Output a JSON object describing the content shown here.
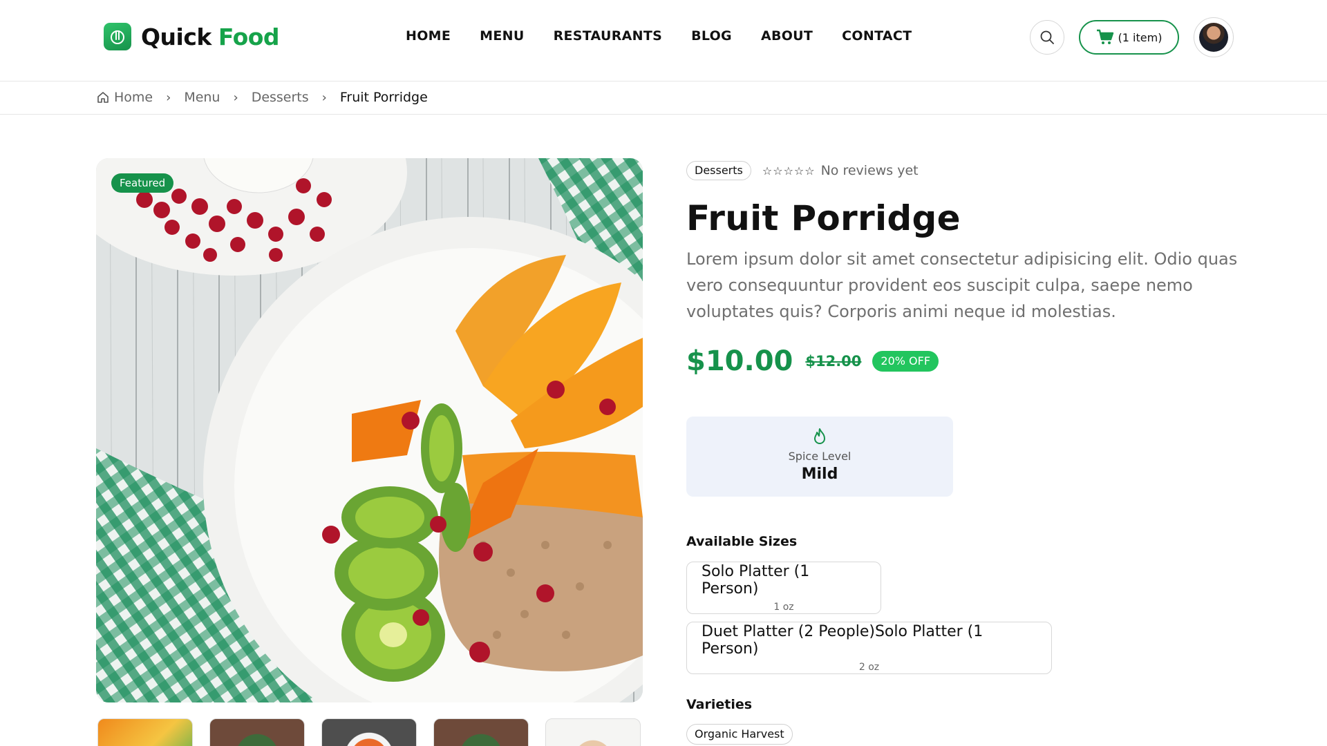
{
  "brand": {
    "name_part1": "Quick",
    "name_part2": "Food",
    "primary_color": "#16924b",
    "accent_color": "#22c55e",
    "icon": "fork-knife-icon"
  },
  "nav": {
    "items": [
      "HOME",
      "MENU",
      "RESTAURANTS",
      "BLOG",
      "ABOUT",
      "CONTACT"
    ]
  },
  "header_actions": {
    "search_icon": "search-icon",
    "cart_icon": "cart-icon",
    "cart_label": "(1 item)",
    "avatar": "user-avatar"
  },
  "breadcrumb": {
    "items": [
      "Home",
      "Menu",
      "Desserts"
    ],
    "current": "Fruit Porridge"
  },
  "product": {
    "featured_badge": "Featured",
    "category": "Desserts",
    "rating_stars": "☆☆☆☆☆",
    "reviews_text": "No reviews yet",
    "title": "Fruit Porridge",
    "description": "Lorem ipsum dolor sit amet consectetur adipisicing elit. Odio quas vero consequuntur provident eos suscipit culpa, saepe nemo voluptates quis? Corporis animi neque id molestias.",
    "price": "$10.00",
    "original_price": "$12.00",
    "discount": "20% OFF",
    "spice": {
      "icon": "flame-icon",
      "label": "Spice Level",
      "value": "Mild"
    },
    "sizes_label": "Available Sizes",
    "sizes": [
      {
        "name": "Solo Platter (1 Person)",
        "qty": "1 oz"
      },
      {
        "name": "Duet Platter (2 People)Solo Platter (1 Person)",
        "qty": "2 oz"
      }
    ],
    "varieties_label": "Varieties",
    "varieties": [
      "Organic Harvest"
    ]
  }
}
